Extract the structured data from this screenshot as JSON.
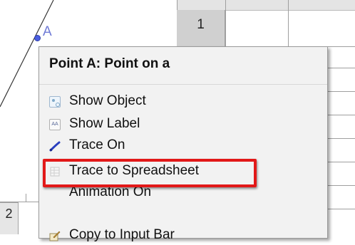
{
  "spreadsheet": {
    "column_header": "1",
    "row_header": "2"
  },
  "graphics": {
    "point_label": "A"
  },
  "popup_menu": {
    "title": "Point A: Point on a",
    "items": [
      {
        "label": "Show Object",
        "icon": "show-object-icon"
      },
      {
        "label": "Show Label",
        "icon": "show-label-icon"
      },
      {
        "label": "Trace On",
        "icon": "trace-pen-icon"
      },
      {
        "label": "Trace to Spreadsheet",
        "icon": "spreadsheet-icon",
        "highlighted": true
      },
      {
        "label": "Animation On",
        "icon": ""
      },
      {
        "label": "Copy to Input Bar",
        "icon": "copy-pencil-icon"
      }
    ],
    "show_label_icon_text": "AA"
  },
  "colors": {
    "highlight": "#e21818",
    "point": "#4a5ee0"
  }
}
